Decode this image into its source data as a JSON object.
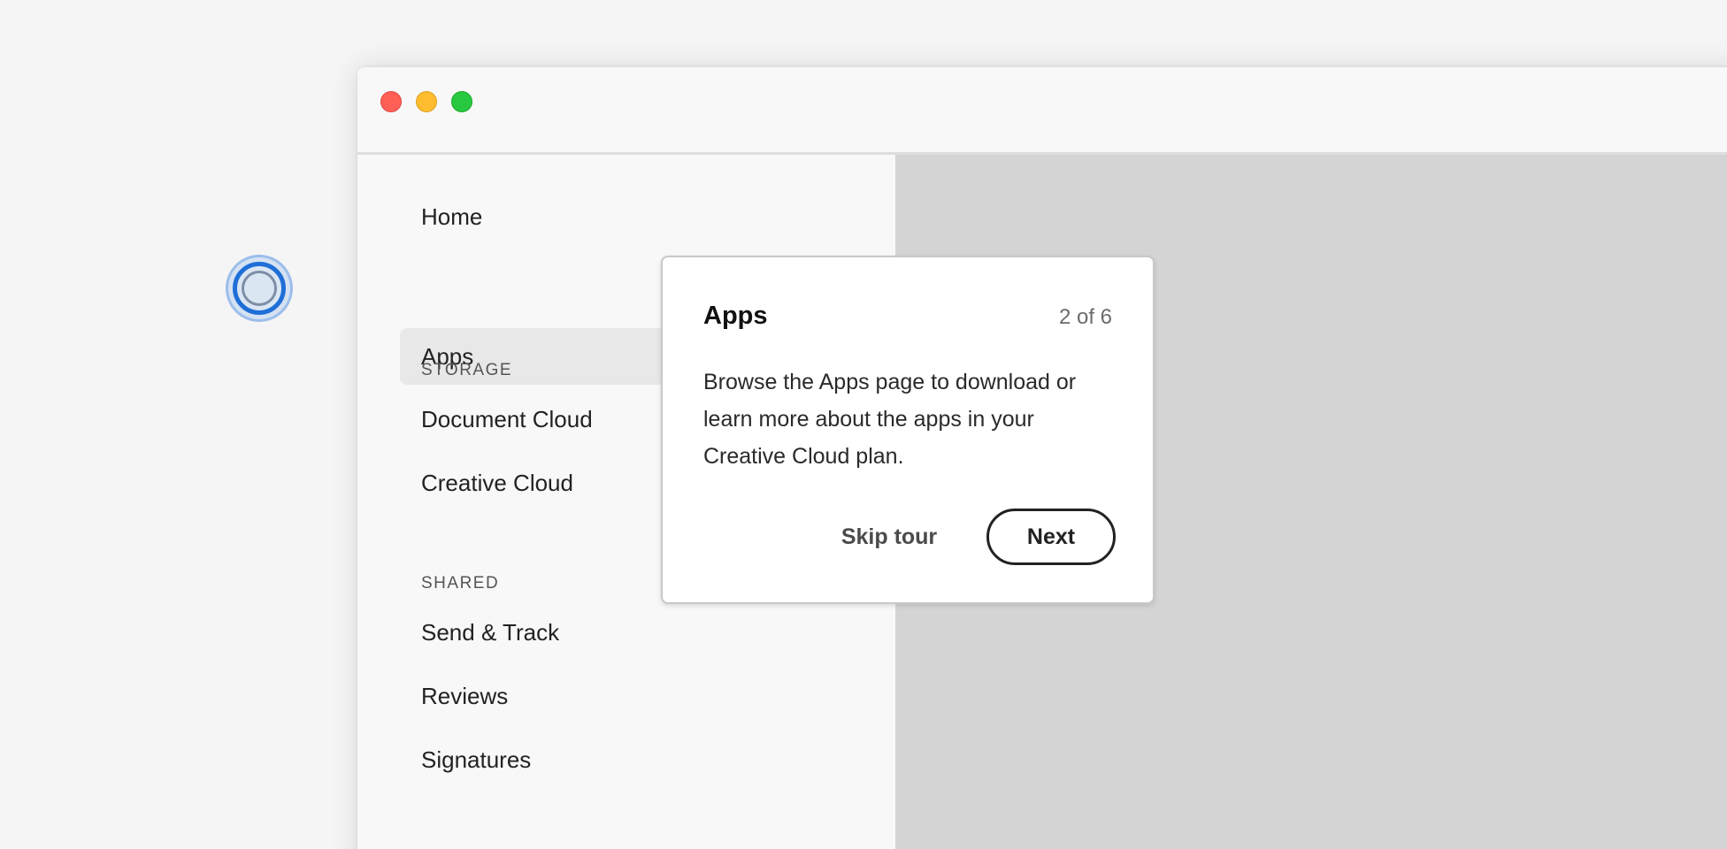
{
  "sidebar": {
    "items": [
      {
        "label": "Home"
      },
      {
        "label": "Apps",
        "selected": true
      }
    ],
    "storage": {
      "label": "STORAGE",
      "items": [
        {
          "label": "Document Cloud"
        },
        {
          "label": "Creative Cloud"
        }
      ]
    },
    "shared": {
      "label": "SHARED",
      "items": [
        {
          "label": "Send & Track"
        },
        {
          "label": "Reviews"
        },
        {
          "label": "Signatures"
        }
      ]
    }
  },
  "coachmark": {
    "title": "Apps",
    "step": "2 of 6",
    "body": "Browse the Apps page to download or learn more about the apps in your Creative Cloud plan.",
    "skip_label": "Skip tour",
    "next_label": "Next"
  },
  "colors": {
    "accent": "#1f6fd8",
    "content_bg": "#d4d4d4",
    "sidebar_bg": "#f8f8f8",
    "selected_bg": "#e8e8e8",
    "traffic_close": "#fe5f57",
    "traffic_minimize": "#febc2e",
    "traffic_zoom": "#28c840"
  },
  "icons": {
    "beacon": "coachmark-beacon-icon"
  }
}
